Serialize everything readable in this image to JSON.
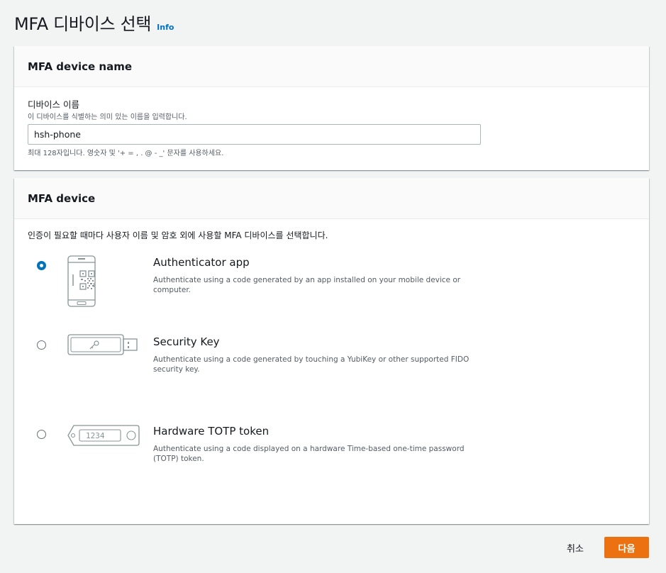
{
  "header": {
    "title": "MFA 디바이스 선택",
    "info_label": "Info"
  },
  "name_panel": {
    "title": "MFA device name",
    "label": "디바이스 이름",
    "description": "이 디바이스를 식별하는 의미 있는 이름을 입력합니다.",
    "input_value": "hsh-phone",
    "constraint": "최대 128자입니다. 영숫자 및 '+ = , . @ - _' 문자를 사용하세요."
  },
  "device_panel": {
    "title": "MFA device",
    "description": "인증이 필요할 때마다 사용자 이름 및 암호 외에 사용할 MFA 디바이스를 선택합니다.",
    "options": [
      {
        "title": "Authenticator app",
        "description": "Authenticate using a code generated by an app installed on your mobile device or computer.",
        "selected": true,
        "icon": "phone-qr-icon"
      },
      {
        "title": "Security Key",
        "description": "Authenticate using a code generated by touching a YubiKey or other supported FIDO security key.",
        "selected": false,
        "icon": "security-key-icon"
      },
      {
        "title": "Hardware TOTP token",
        "description": "Authenticate using a code displayed on a hardware Time-based one-time password (TOTP) token.",
        "selected": false,
        "icon": "totp-token-icon",
        "token_display": "1234"
      }
    ]
  },
  "footer": {
    "cancel_label": "취소",
    "next_label": "다음"
  },
  "colors": {
    "accent": "#0073bb",
    "primary_button": "#ec7211",
    "background": "#f2f3f3"
  }
}
